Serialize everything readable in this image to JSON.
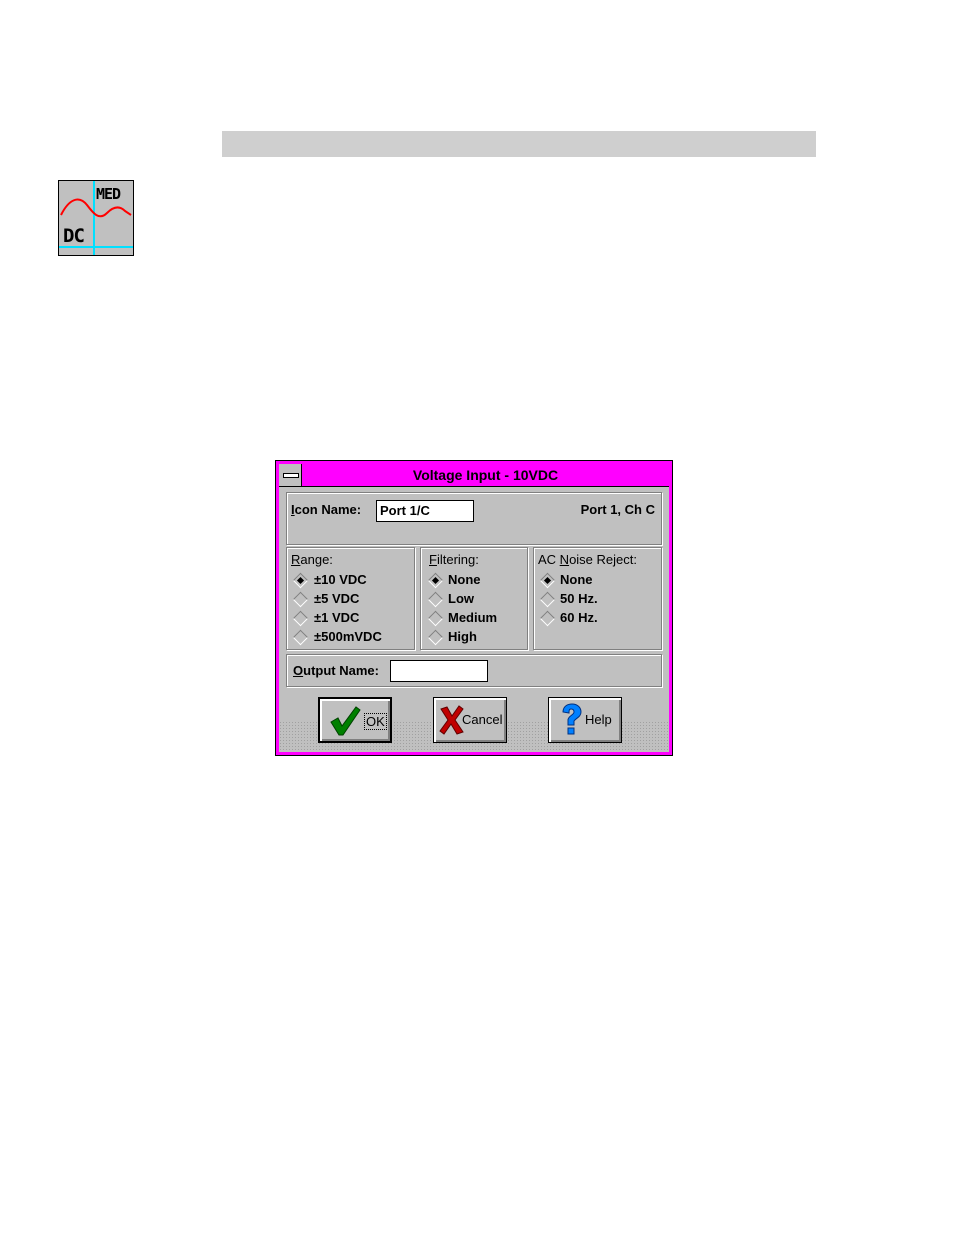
{
  "app_icon": {
    "top_text": "MED",
    "bottom_text": "DC",
    "icon": "chart-wave-icon"
  },
  "dialog": {
    "title": "Voltage Input - 10VDC",
    "icon_name": {
      "label": "Icon Name:",
      "value": "Port 1/C",
      "port_info": "Port 1, Ch C"
    },
    "range": {
      "label": "Range:",
      "options": [
        "±10 VDC",
        "±5 VDC",
        "±1 VDC",
        "±500mVDC"
      ],
      "selected": 0
    },
    "filtering": {
      "label": "Filtering:",
      "options": [
        "None",
        "Low",
        "Medium",
        "High"
      ],
      "selected": 0
    },
    "ac_noise": {
      "label": "AC Noise Reject:",
      "options": [
        "None",
        "50 Hz.",
        "60 Hz."
      ],
      "selected": 0
    },
    "output_name": {
      "label": "Output Name:",
      "value": ""
    },
    "buttons": {
      "ok": "OK",
      "cancel": "Cancel",
      "help": "Help"
    },
    "colors": {
      "frame": "#ff00ff",
      "face": "#c0c0c0",
      "ok_check": "#008000",
      "cancel_x": "#c00000",
      "help_q": "#0080ff"
    }
  }
}
